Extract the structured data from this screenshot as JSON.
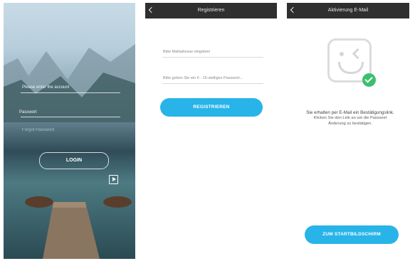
{
  "login": {
    "account_placeholder": "Please enter the account",
    "password_placeholder": "Passwort",
    "forgot_text": "Forgot Password",
    "login_label": "LOGIN"
  },
  "register": {
    "title": "Registrieren",
    "email_placeholder": "Bitte Mailadresse eingeben",
    "password_placeholder": "Bitte geben Sie ein 6 - 16-stelliges Passwort...",
    "submit_label": "REGISTRIEREN"
  },
  "activation": {
    "title": "Aktivierung E-Mail",
    "line1": "Sie erhalten per E-Mail ein Bestätigungslink.",
    "line2": "Klicken Sie den Link an um die Passwort",
    "line3": "Änderung zu bestätigen.",
    "home_label": "ZUM STARTBILDSCHIRM"
  },
  "colors": {
    "accent": "#28b4e8",
    "topbar": "#2f2f2f",
    "success": "#3cc06e"
  },
  "icons": [
    "chevron-left-icon",
    "play-icon",
    "face-icon",
    "check-icon"
  ]
}
